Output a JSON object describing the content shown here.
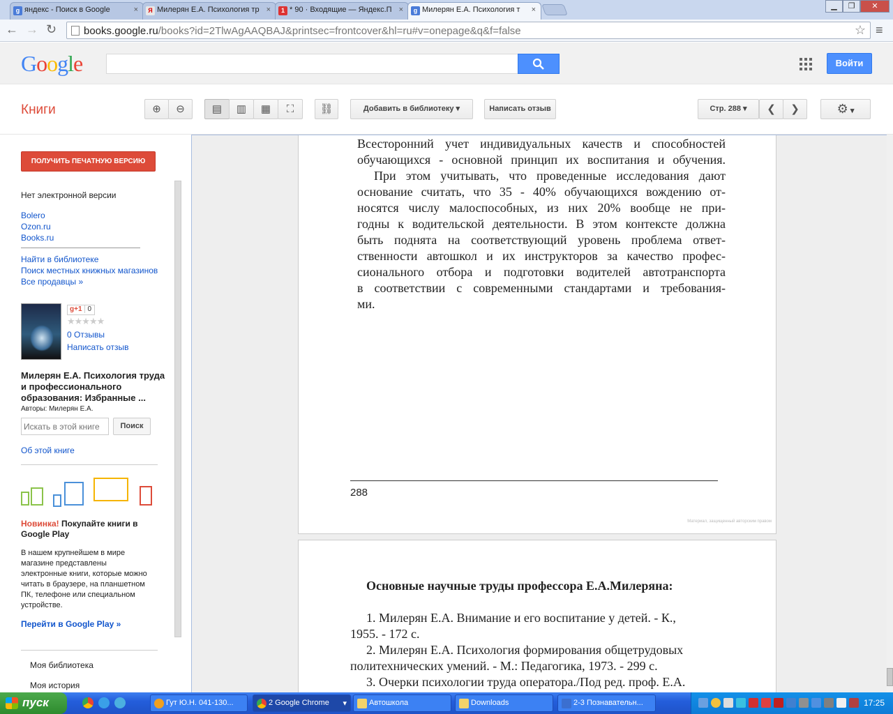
{
  "browser": {
    "tabs": [
      {
        "title": "яндекс - Поиск в Google",
        "fav": "g",
        "favcolor": "#4a7bd8"
      },
      {
        "title": "Милерян Е.А. Психология тр",
        "fav": "Я",
        "favcolor": "#e8e8e8"
      },
      {
        "title": "* 90 · Входящие — Яндекс.П",
        "fav": "1",
        "favcolor": "#dd3333"
      },
      {
        "title": "Милерян Е.А. Психология т",
        "fav": "g",
        "favcolor": "#4a7bd8"
      }
    ],
    "tab_close": "×",
    "url_host": "books.google.ru",
    "url_path": "/books?id=2TlwAgAAQBAJ&printsec=frontcover&hl=ru#v=onepage&q&f=false"
  },
  "google": {
    "logo": [
      "G",
      "o",
      "o",
      "g",
      "l",
      "e"
    ],
    "logo_colors": [
      "#4285f4",
      "#ea4335",
      "#fbbc05",
      "#4285f4",
      "#34a853",
      "#ea4335"
    ],
    "login_label": "Войти"
  },
  "books_toolbar": {
    "title": "Книги",
    "add_library": "Добавить в библиотеку",
    "write_review": "Написать отзыв",
    "page_label": "Стр. 288"
  },
  "left": {
    "print_btn": "ПОЛУЧИТЬ ПЕЧАТНУЮ ВЕРСИЮ",
    "no_ebook": "Нет электронной версии",
    "stores": [
      "Bolero",
      "Ozon.ru",
      "Books.ru"
    ],
    "find_library": "Найти в библиотеке",
    "local_stores": "Поиск местных книжных магазинов",
    "all_sellers": "Все продавцы »",
    "gplus": "g+1",
    "gplus_count": "0",
    "stars": "★★★★★",
    "reviews": "0 Отзывы",
    "write_review": "Написать отзыв",
    "book_title": "Милерян Е.А. Психология труда и профессионального образования: Избранные ...",
    "authors": "Авторы: Милерян Е.А.",
    "search_placeholder": "Искать в этой книге",
    "search_btn": "Поиск",
    "about": "Об этой книге",
    "promo_new": "Новинка!",
    "promo_title": " Покупайте книги в Google Play",
    "promo_desc": "В нашем крупнейшем в мире магазине представлены электронные книги, которые можно читать в браузере, на планшетном ПК, телефоне или специальном устройстве.",
    "play_link": "Перейти в Google Play »",
    "my_library": "Моя библиотека",
    "my_history": "Моя история"
  },
  "page1": {
    "lines": [
      "Всесторонний учет индивидуальных качеств и способностей",
      "обучающихся - основной принцип их воспитания и обучения.",
      "При этом учитывать, что проведенные исследования дают",
      "основание считать, что 35 - 40% обучающихся вождению от-",
      "носятся  числу малоспособных, из них 20% вообще не при-",
      "годны к водительской деятельности. В этом контексте должна",
      "быть поднята на соответствующий  уровень проблема ответ-",
      "ственности автошкол и их инструкторов за качество профес-",
      "сионального отбора и подготовки водителей автотранспорта",
      "в соответствии с современными стандартами и требования-"
    ],
    "last_line": "ми.",
    "page_number": "288",
    "copyright": "Материал, защищенный авторским правом"
  },
  "page2": {
    "heading": "Основные научные труды профессора Е.А.Милеряна:",
    "lines": [
      "1. Милерян Е.А. Внимание и его воспитание у детей. - К.,",
      "1955. - 172 с.",
      "2. Милерян Е.А. Психология формирования общетрудовых",
      "политехнических умений. -  М.: Педагогика, 1973. - 299 с.",
      "3. Очерки психологии труда оператора./Под ред. проф. Е.А."
    ]
  },
  "taskbar": {
    "start": "пуск",
    "tasks": [
      {
        "label": "Гут Ю.Н. 041-130...",
        "color": "#f0a020"
      },
      {
        "label": "2 Google Chrome",
        "color": "#4a9a4a"
      },
      {
        "label": "Автошкола",
        "color": "#f3d36b"
      },
      {
        "label": "Downloads",
        "color": "#f3d36b"
      },
      {
        "label": "2-3 Познавательн...",
        "color": "#3b6fd0"
      }
    ],
    "clock": "17:25"
  }
}
